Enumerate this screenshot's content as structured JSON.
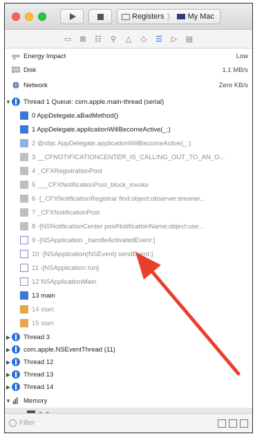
{
  "toolbar": {
    "scheme": "Registers",
    "scheme_separator": "〉",
    "destination": "My Mac"
  },
  "navigator_icons": [
    "project-navigator-icon",
    "source-control-icon",
    "symbol-navigator-icon",
    "find-icon",
    "issue-icon",
    "test-icon",
    "debug-navigator-icon",
    "breakpoint-icon",
    "report-icon"
  ],
  "gauges": [
    {
      "label": "Energy Impact",
      "value": "Low"
    },
    {
      "label": "Disk",
      "value": "1.1 MB/s"
    },
    {
      "label": "Network",
      "value": "Zero KB/s"
    }
  ],
  "thread1": {
    "label": "Thread 1 Queue: com.apple.main-thread (serial)",
    "frames": [
      {
        "text": "0 AppDelegate.aBadMethod()",
        "kind": "user"
      },
      {
        "text": "1 AppDelegate.applicationWillBecomeActive(_:)",
        "kind": "user"
      },
      {
        "text": "2 @objc AppDelegate.applicationWillBecomeActive(_:)",
        "kind": "user-light"
      },
      {
        "text": "3 __CFNOTIFICATIONCENTER_IS_CALLING_OUT_TO_AN_O...",
        "kind": "sys"
      },
      {
        "text": "4 _CFXRegistrationPost",
        "kind": "sys"
      },
      {
        "text": "5 ___CFXNotificationPost_block_invoke",
        "kind": "sys"
      },
      {
        "text": "6 -[_CFXNotificationRegistrar find:object:observer:enumer...",
        "kind": "sys"
      },
      {
        "text": "7 _CFXNotificationPost",
        "kind": "sys"
      },
      {
        "text": "8 -[NSNotificationCenter postNotificationName:object:use...",
        "kind": "sys"
      },
      {
        "text": "9 -[NSApplication _handleActivatedEvent:]",
        "kind": "app"
      },
      {
        "text": "10 -[NSApplication(NSEvent) sendEvent:]",
        "kind": "app"
      },
      {
        "text": "11 -[NSApplication run]",
        "kind": "app"
      },
      {
        "text": "12 NSApplicationMain",
        "kind": "app"
      },
      {
        "text": "13 main",
        "kind": "user"
      },
      {
        "text": "14 start",
        "kind": "obj"
      },
      {
        "text": "15 start",
        "kind": "obj"
      }
    ]
  },
  "threads": [
    {
      "label": "Thread 3"
    },
    {
      "label": "com.apple.NSEventThread (11)"
    },
    {
      "label": "Thread 12"
    },
    {
      "label": "Thread 13"
    },
    {
      "label": "Thread 14"
    }
  ],
  "memory": {
    "label": "Memory",
    "child": "0x0"
  },
  "filter": {
    "placeholder": "Filter"
  },
  "colors": {
    "arrow": "#e8402c",
    "user_frame": "#3a78d8",
    "selection": "#e8e8e8"
  }
}
